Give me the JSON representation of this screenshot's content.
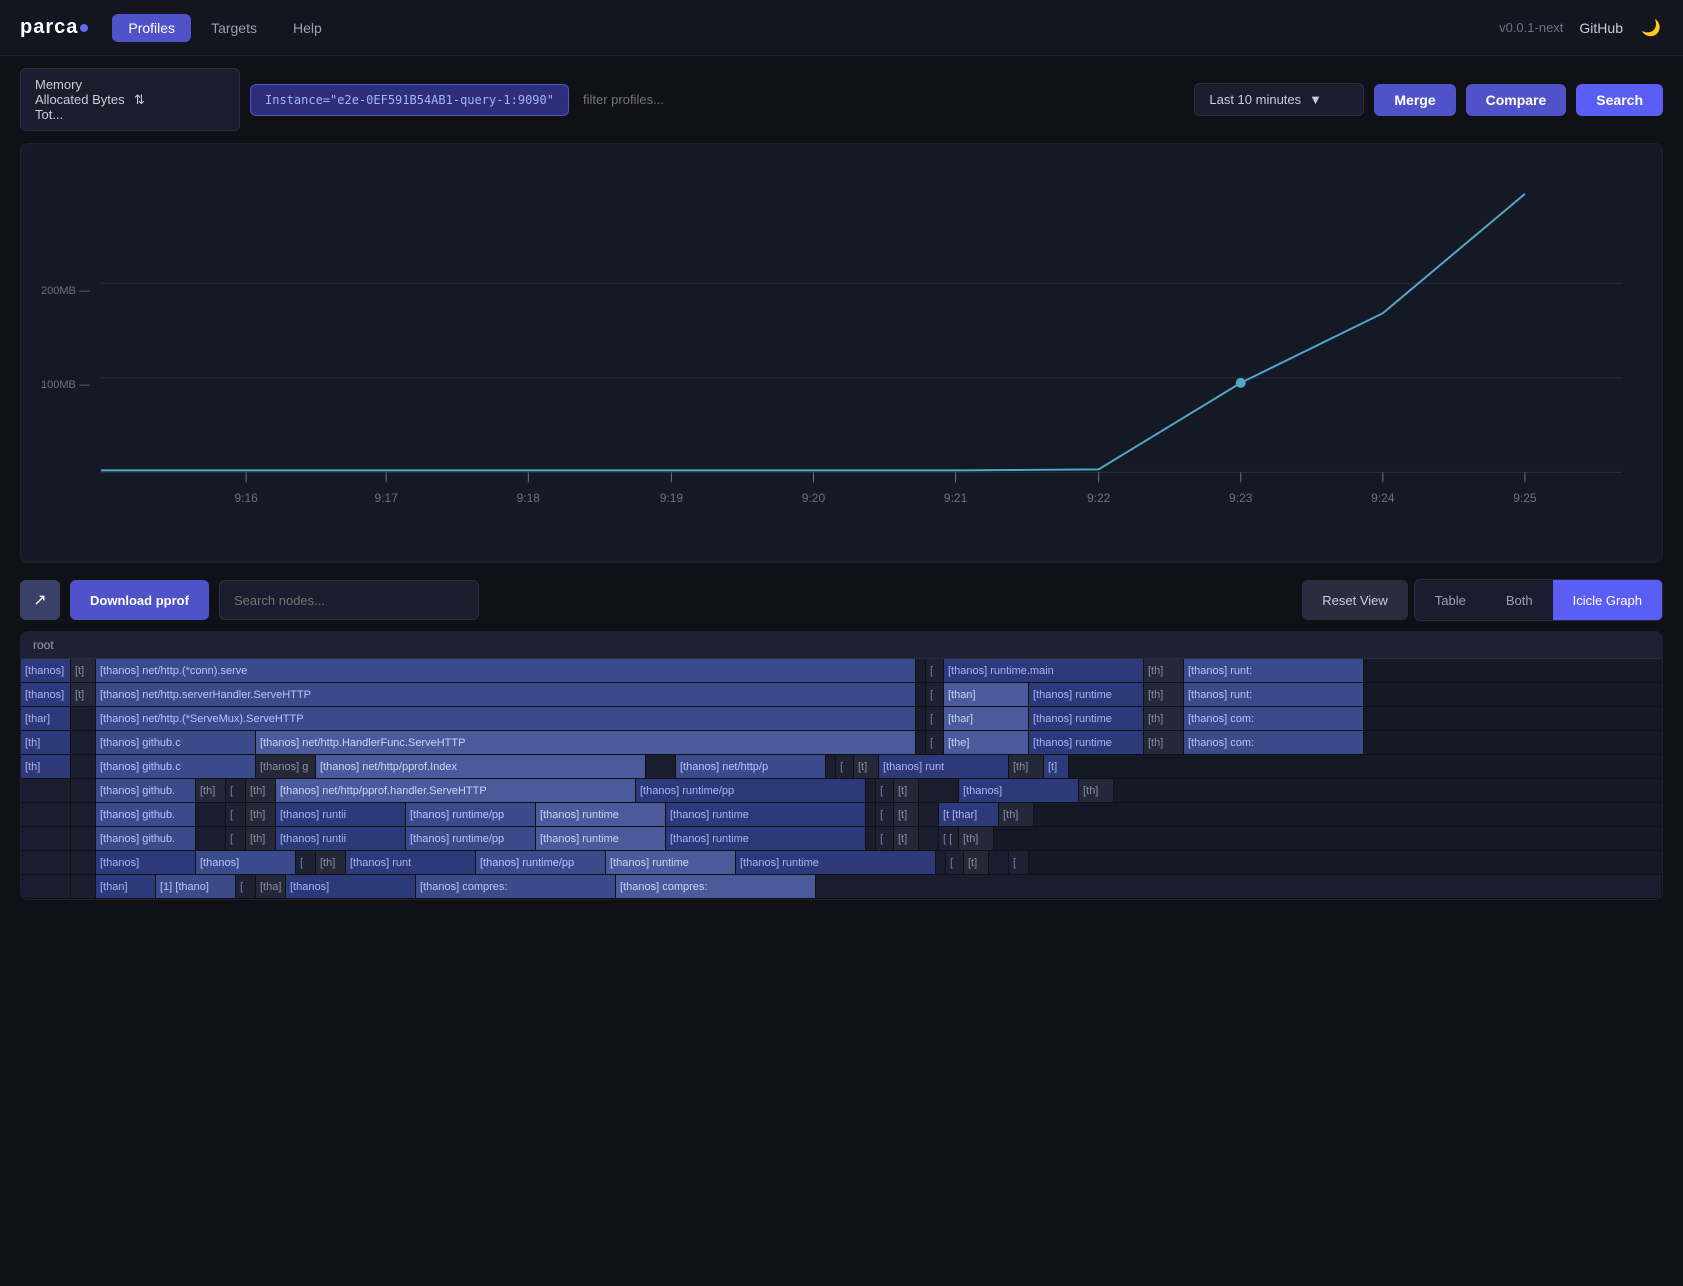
{
  "header": {
    "logo": "parca",
    "nav": [
      {
        "label": "Profiles",
        "active": true
      },
      {
        "label": "Targets",
        "active": false
      },
      {
        "label": "Help",
        "active": false
      }
    ],
    "version": "v0.0.1-next",
    "github": "GitHub"
  },
  "toolbar": {
    "profile_type": "Memory Allocated Bytes Tot...",
    "instance_tag": "Instance=\"e2e-0EF591B54AB1-query-1:9090\"",
    "filter_placeholder": "filter profiles...",
    "time_range": "Last 10 minutes",
    "merge_label": "Merge",
    "compare_label": "Compare",
    "search_label": "Search"
  },
  "chart": {
    "y_labels": [
      "200MB —",
      "100MB —"
    ],
    "x_labels": [
      "9:16",
      "9:17",
      "9:18",
      "9:19",
      "9:20",
      "9:21",
      "9:22",
      "9:23",
      "9:24",
      "9:25"
    ]
  },
  "flamegraph": {
    "share_icon": "↗",
    "download_label": "Download pprof",
    "search_placeholder": "Search nodes...",
    "reset_view_label": "Reset View",
    "view_options": [
      {
        "label": "Table",
        "active": false
      },
      {
        "label": "Both",
        "active": false
      },
      {
        "label": "Icicle Graph",
        "active": true
      }
    ],
    "root_label": "root",
    "rows": [
      [
        "[thanos]",
        "[t]",
        "[thanos] net/http.(*conn).serve",
        "",
        "",
        "",
        "",
        "",
        "",
        "",
        "",
        "[",
        "[thanos] runtime.main",
        "[th]",
        "[thanos] runt:"
      ],
      [
        "[thanos]",
        "[t]",
        "[thanos] net/http.serverHandler.ServeHTTP",
        "",
        "",
        "",
        "",
        "",
        "",
        "",
        "",
        "[",
        "[than] [thanos] runtime",
        "[th]",
        "[thanos] runt:"
      ],
      [
        "[thar]",
        "",
        "[thanos] net/http.(*ServeMux).ServeHTTP",
        "",
        "",
        "",
        "",
        "",
        "",
        "",
        "",
        "[",
        "[thar] [thanos] runtime",
        "[th]",
        "[thanos] com:"
      ],
      [
        "[th]",
        "",
        "[thanos] github.c",
        "[thanos] net/http.HandlerFunc.ServeHTTP",
        "",
        "",
        "",
        "",
        "",
        "",
        "",
        "[",
        "[the] [thanos] runtime",
        "[th]",
        "[thanos] com:"
      ],
      [
        "[th]",
        "",
        "[thanos] github.c",
        "[thanos] g",
        "[thanos] net/http/pprof.Index",
        "",
        "[thanos] net/http/p",
        "",
        "",
        "",
        "",
        "[",
        "[t]",
        "[thanos] runt",
        "[th]",
        "[t]"
      ],
      [
        "",
        "",
        "[thanos] github.",
        "[th]",
        "[",
        "[th]",
        "[thanos] net/http/pprof.handler.ServeHTTP",
        "[thanos] runtime/pp",
        "",
        "",
        "",
        "[",
        "[t]",
        "",
        "[thanos]",
        "[th]"
      ],
      [
        "",
        "",
        "[thanos] github.",
        "",
        "[",
        "[th]",
        "[thanos] runtii",
        "[thanos] runtime/pp",
        "[thanos] runtime",
        "[thanos] runtime",
        "",
        "[",
        "[t]",
        "",
        "[t [thar]",
        "[th]"
      ],
      [
        "",
        "",
        "[thanos] github.",
        "",
        "[",
        "[th]",
        "[thanos] runtii",
        "[thanos] runtime/pp",
        "[thanos] runtime",
        "[thanos] runtime",
        "",
        "[",
        "[t]",
        "",
        "[ [",
        "[th]"
      ],
      [
        "",
        "",
        "[thanos]",
        "[thanos]",
        "[",
        "[th]",
        "[thanos] runt",
        "[thanos] runtime/pp",
        "[thanos] runtime",
        "[thanos] runtime",
        "",
        "[",
        "[t]",
        "",
        "[",
        ""
      ],
      [
        "",
        "",
        "[than]",
        "[1] [thano]",
        "[",
        "[tha]",
        "[thanos]",
        "[thanos] compres:",
        "[thanos] compres:",
        "",
        "",
        "",
        "",
        "",
        "",
        ""
      ]
    ]
  }
}
